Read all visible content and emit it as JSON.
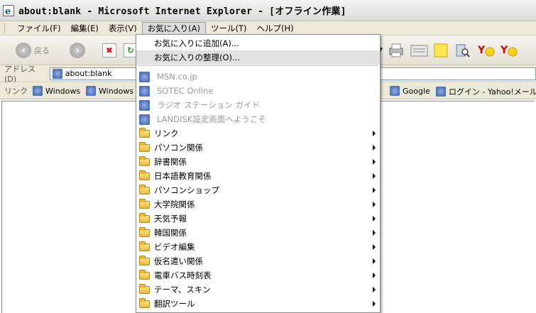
{
  "window": {
    "title": "about:blank - Microsoft Internet Explorer - [オフライン作業]"
  },
  "menu": [
    {
      "label": "ファイル(F)"
    },
    {
      "label": "編集(E)"
    },
    {
      "label": "表示(V)"
    },
    {
      "label": "お気に入り(A)"
    },
    {
      "label": "ツール(T)"
    },
    {
      "label": "ヘルプ(H)"
    }
  ],
  "toolbar": {
    "back_label": "戻る"
  },
  "address": {
    "label": "アドレス(D)",
    "value": "about:blank"
  },
  "links": {
    "label": "リンク",
    "items": [
      "Windows",
      "Windows",
      "Google",
      "ログイン - Yahoo!メール"
    ]
  },
  "favorites_menu": {
    "actions": [
      "お気に入りに追加(A)...",
      "お気に入りの整理(O)..."
    ],
    "favorites": [
      "MSN.co.jp",
      "SOTEC Online",
      "ラジオ ステーション ガイド",
      "LANDISK設定画面へようこそ"
    ],
    "folders": [
      "リンク",
      "パソコン関係",
      "辞書関係",
      "日本語教育関係",
      "パソコンショップ",
      "大学院関係",
      "天気予報",
      "韓国関係",
      "ビデオ編集",
      "仮名遣い関係",
      "電車バス時刻表",
      "テーマ、スキン",
      "翻訳ツール"
    ]
  },
  "colors": {
    "accent": "#2a5db0",
    "disabled": "#9a9a9a",
    "highlight": "#e1e1e1"
  }
}
